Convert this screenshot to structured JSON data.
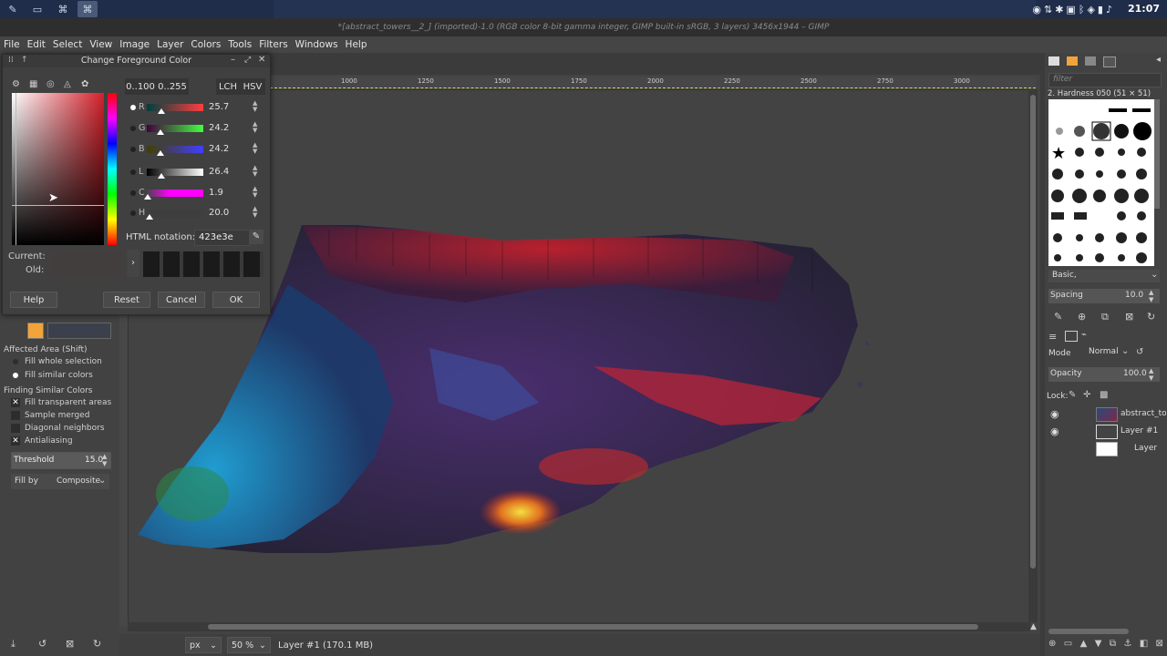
{
  "panel": {
    "clock": "21:07"
  },
  "window": {
    "title": "*[abstract_towers__2_] (imported)-1.0 (RGB color 8-bit gamma integer, GIMP built-in sRGB, 3 layers) 3456x1944 – GIMP"
  },
  "menu": [
    "File",
    "Edit",
    "Select",
    "View",
    "Image",
    "Layer",
    "Colors",
    "Tools",
    "Filters",
    "Windows",
    "Help"
  ],
  "dialog": {
    "title": "Change Foreground Color",
    "range_0_100": "0..100",
    "range_0_255": "0..255",
    "lch": "LCH",
    "hsv": "HSV",
    "sliders": [
      {
        "label": "R",
        "value": "25.7",
        "frac": 0.257
      },
      {
        "label": "G",
        "value": "24.2",
        "frac": 0.242
      },
      {
        "label": "B",
        "value": "24.2",
        "frac": 0.242
      },
      {
        "label": "L",
        "value": "26.4",
        "frac": 0.264
      },
      {
        "label": "C",
        "value": "1.9",
        "frac": 0.019
      },
      {
        "label": "H",
        "value": "20.0",
        "frac": 0.055
      }
    ],
    "html_notation_label": "HTML notation:",
    "html_notation_value": "423e3e",
    "current_label": "Current:",
    "old_label": "Old:",
    "help": "Help",
    "reset": "Reset",
    "cancel": "Cancel",
    "ok": "OK"
  },
  "tool_options": {
    "affected_area": "Affected Area  (Shift)",
    "fill_whole": "Fill whole selection",
    "fill_similar": "Fill similar colors",
    "finding_similar": "Finding Similar Colors",
    "fill_transparent": "Fill transparent areas",
    "sample_merged": "Sample merged",
    "diagonal_neighbors": "Diagonal neighbors",
    "antialiasing": "Antialiasing",
    "threshold_label": "Threshold",
    "threshold_value": "15.0",
    "fill_by_label": "Fill by",
    "fill_by_value": "Composite"
  },
  "ruler": {
    "ticks": [
      "1000",
      "1250",
      "1500",
      "1750",
      "2000",
      "2250",
      "2500",
      "2750",
      "3000"
    ]
  },
  "status": {
    "unit": "px",
    "zoom": "50 %",
    "layer_info": "Layer #1 (170.1 MB)"
  },
  "brushes": {
    "filter_placeholder": "filter",
    "current": "2. Hardness 050 (51 × 51)",
    "preset": "Basic,",
    "spacing_label": "Spacing",
    "spacing_value": "10.0"
  },
  "layers": {
    "mode_label": "Mode",
    "mode_value": "Normal",
    "opacity_label": "Opacity",
    "opacity_value": "100.0",
    "lock_label": "Lock:",
    "items": [
      {
        "name": "abstract_tov",
        "visible": true
      },
      {
        "name": "Layer #1",
        "visible": true
      },
      {
        "name": "Layer",
        "visible": false
      }
    ]
  },
  "colors": {
    "accent": "#f2a33a",
    "fg_current": "#423e3e"
  }
}
